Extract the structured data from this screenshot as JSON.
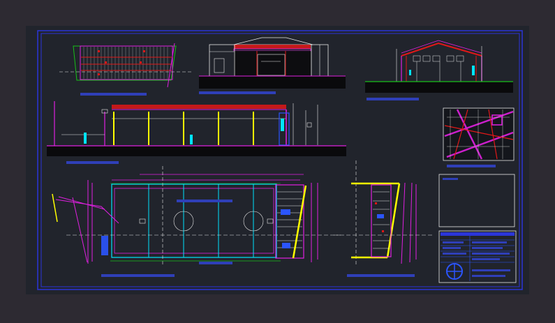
{
  "drawing": {
    "colors": {
      "page_bg": "#2d2a32",
      "sheet_bg": "#21242c",
      "border": "#2b35d8",
      "red": "#e01818",
      "magenta": "#e020e0",
      "yellow": "#ffff00",
      "cyan": "#00e5ff",
      "white": "#e8e8e8",
      "green": "#18c018",
      "blue": "#2b55ff",
      "label": "#2f3fb8"
    }
  }
}
